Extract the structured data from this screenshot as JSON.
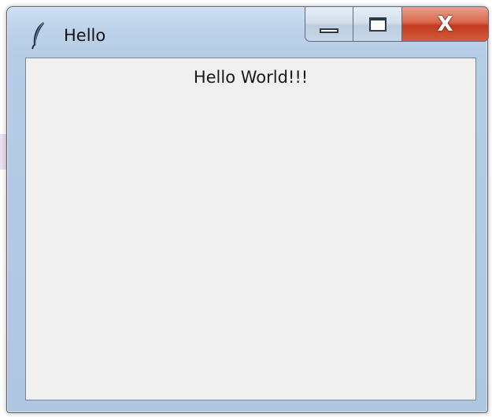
{
  "window": {
    "title": "Hello",
    "icon": "tk-feather-icon"
  },
  "caption_buttons": {
    "minimize_icon": "minimize-icon",
    "maximize_icon": "maximize-icon",
    "close_label": "X"
  },
  "content": {
    "label_text": "Hello World!!!"
  },
  "colors": {
    "client_background": "#f0f0f0",
    "close_button": "#c7422a",
    "frame": "#b9cfe6"
  }
}
